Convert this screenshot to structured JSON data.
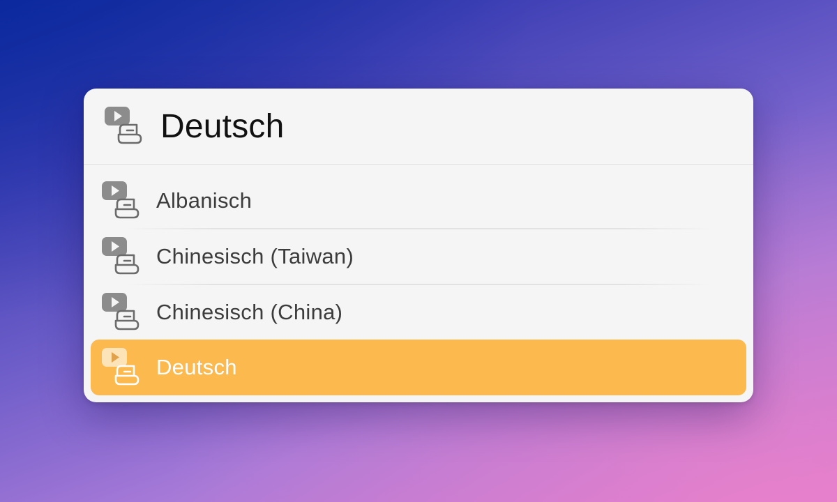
{
  "search": {
    "query": "Deutsch",
    "icon": "subtitles-language-icon"
  },
  "results": [
    {
      "label": "Albanisch",
      "icon": "subtitles-language-icon",
      "selected": false
    },
    {
      "label": "Chinesisch (Taiwan)",
      "icon": "subtitles-language-icon",
      "selected": false
    },
    {
      "label": "Chinesisch (China)",
      "icon": "subtitles-language-icon",
      "selected": false
    },
    {
      "label": "Deutsch",
      "icon": "subtitles-language-icon",
      "selected": true
    }
  ],
  "colors": {
    "selection": "#fbb94e",
    "icon": "#808080",
    "icon_selected": "#ffffff"
  }
}
